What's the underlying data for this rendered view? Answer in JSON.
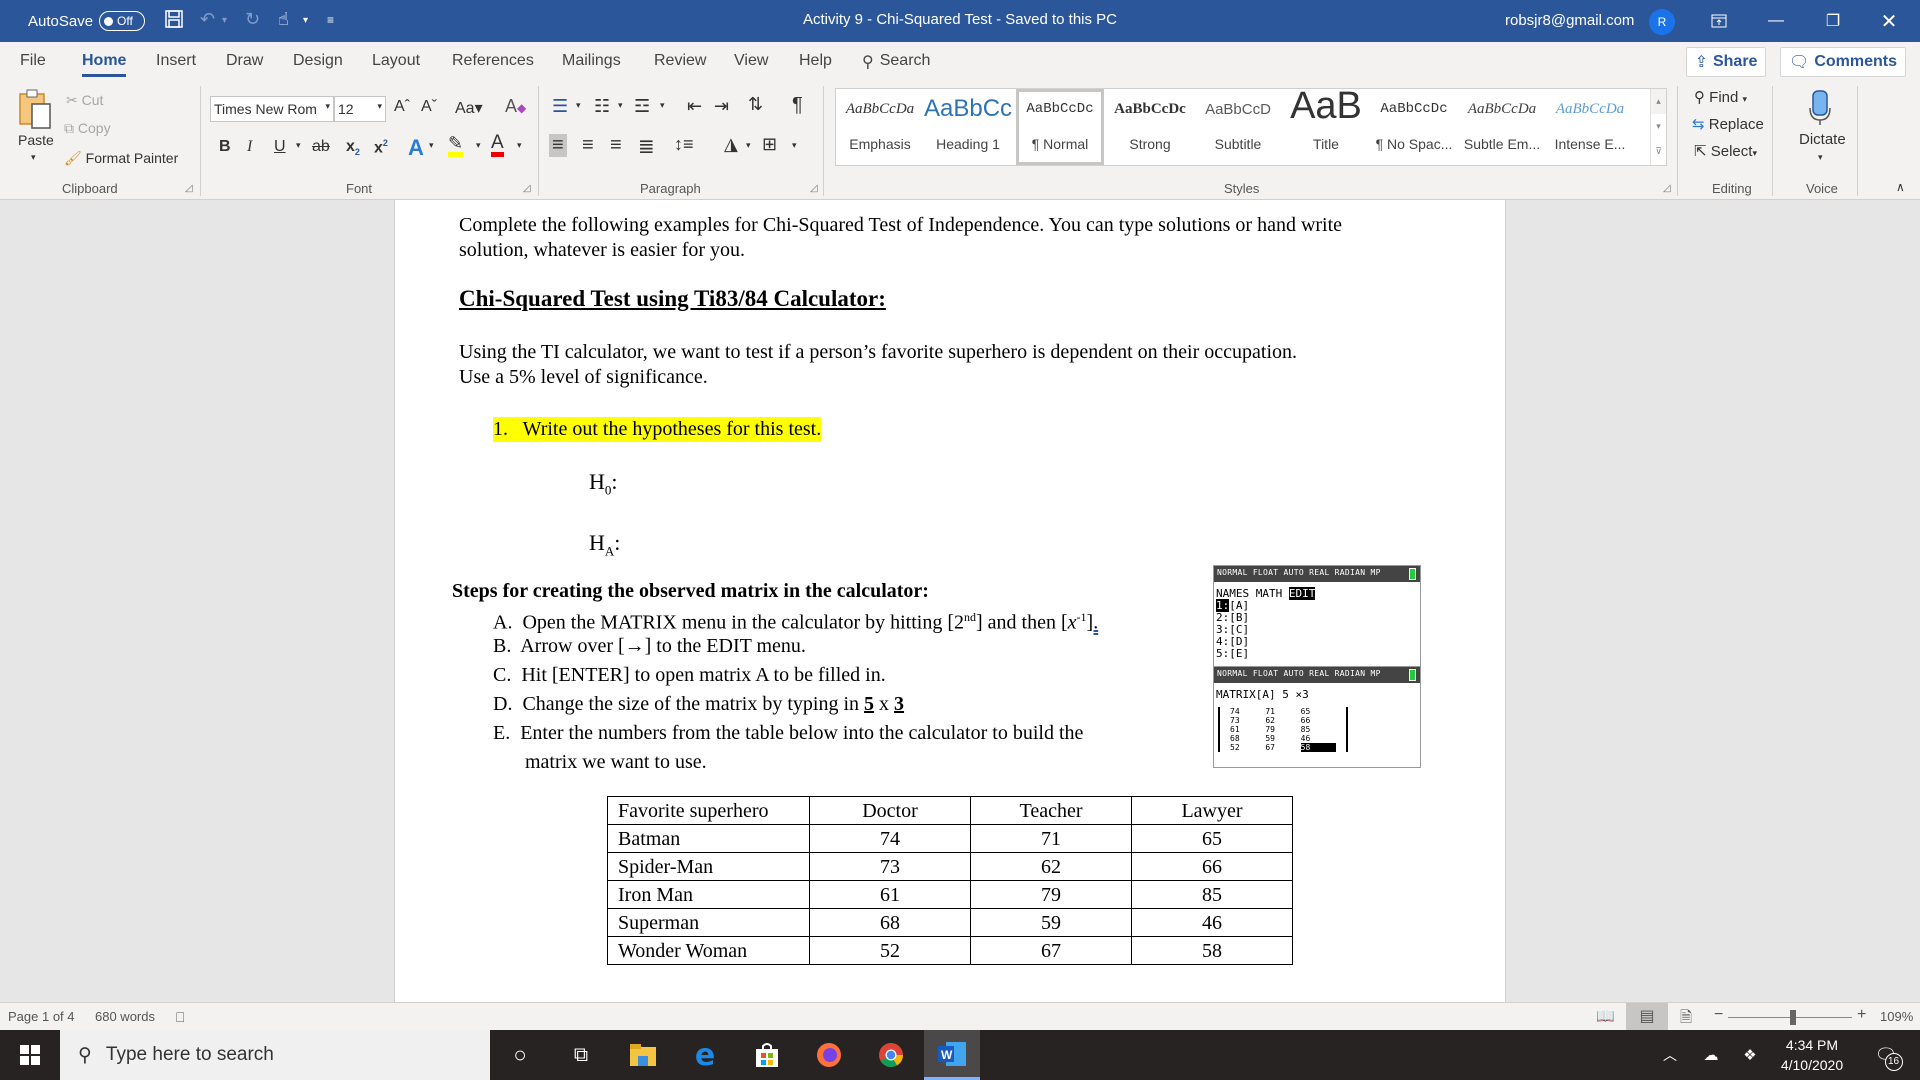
{
  "titlebar": {
    "autosave_label": "AutoSave",
    "autosave_state": "Off",
    "doc_title": "Activity 9 - Chi-Squared Test  -  Saved to this PC",
    "account": "robsjr8@gmail.com",
    "avatar_initial": "R",
    "icons": [
      "save-icon",
      "undo-icon",
      "redo-icon",
      "touch-mode-icon",
      "customize-qat-icon"
    ]
  },
  "menu": {
    "tabs": [
      "File",
      "Home",
      "Insert",
      "Draw",
      "Design",
      "Layout",
      "References",
      "Mailings",
      "Review",
      "View",
      "Help"
    ],
    "active_tab": "Home",
    "search_label": "Search",
    "share_label": "Share",
    "comments_label": "Comments"
  },
  "ribbon": {
    "clipboard": {
      "paste": "Paste",
      "cut": "Cut",
      "copy": "Copy",
      "format_painter": "Format Painter",
      "label": "Clipboard"
    },
    "font": {
      "font_name": "Times New Rom",
      "font_size": "12",
      "label": "Font",
      "change_case": "Aa"
    },
    "paragraph": {
      "label": "Paragraph"
    },
    "styles": {
      "label": "Styles",
      "items": [
        {
          "preview": "AaBbCcDa",
          "name": "Emphasis"
        },
        {
          "preview": "AaBbCc",
          "name": "Heading 1"
        },
        {
          "preview": "AaBbCcDc",
          "name": "¶ Normal"
        },
        {
          "preview": "AaBbCcDc",
          "name": "Strong"
        },
        {
          "preview": "AaBbCcD",
          "name": "Subtitle"
        },
        {
          "preview": "AaB",
          "name": "Title"
        },
        {
          "preview": "AaBbCcDc",
          "name": "¶ No Spac..."
        },
        {
          "preview": "AaBbCcDa",
          "name": "Subtle Em..."
        },
        {
          "preview": "AaBbCcDa",
          "name": "Intense E..."
        }
      ],
      "selected": "¶ Normal"
    },
    "editing": {
      "find": "Find",
      "replace": "Replace",
      "select": "Select",
      "label": "Editing"
    },
    "voice": {
      "dictate": "Dictate",
      "label": "Voice"
    }
  },
  "document": {
    "intro_line1": "Complete the following examples for Chi-Squared Test of Independence. You can type solutions or hand write",
    "intro_line2": "solution, whatever is easier for you.",
    "heading": "Chi-Squared Test using Ti83/84 Calculator:",
    "problem_line1": "Using the TI calculator, we want to test if a person’s favorite superhero is dependent on their occupation.",
    "problem_line2": "Use a 5% level of significance.",
    "q1": "1.   Write out the hypotheses for this test.",
    "h0": "H",
    "h0_sub": "0",
    "ha": "H",
    "ha_sub": "A",
    "colon": ":",
    "steps_heading": "Steps for creating the observed matrix in the calculator:",
    "steps": {
      "A_pre": "A.  Open the MATRIX menu in the calculator by hitting [2",
      "A_sup": "nd",
      "A_mid": "] and then [",
      "A_x": "x",
      "A_sup2": "-1",
      "A_end": "].",
      "B": "B.  Arrow over [→] to the EDIT menu.",
      "C": "C.  Hit [ENTER] to open matrix A to be filled in.",
      "D_pre": "D.  Change the size of the matrix by typing in ",
      "D_5": "5",
      "D_x": " x ",
      "D_3": "3",
      "E1": "E.  Enter the numbers from the table below into the calculator to build the",
      "E2": "matrix we want to use."
    },
    "calculator": {
      "status": "NORMAL FLOAT AUTO REAL RADIAN MP",
      "menu_names": "NAMES",
      "menu_math": "MATH",
      "menu_edit": "EDIT",
      "list": [
        "1:[A]",
        "2:[B]",
        "3:[C]",
        "4:[D]",
        "5:[E]"
      ],
      "matrix_title": "MATRIX[A]  5 ×3",
      "matrix": [
        [
          "74",
          "71",
          "65"
        ],
        [
          "73",
          "62",
          "66"
        ],
        [
          "61",
          "79",
          "85"
        ],
        [
          "68",
          "59",
          "46"
        ],
        [
          "52",
          "67",
          "58"
        ]
      ]
    },
    "table": {
      "headers": [
        "Favorite superhero",
        "Doctor",
        "Teacher",
        "Lawyer"
      ],
      "rows": [
        [
          "Batman",
          "74",
          "71",
          "65"
        ],
        [
          "Spider-Man",
          "73",
          "62",
          "66"
        ],
        [
          "Iron Man",
          "61",
          "79",
          "85"
        ],
        [
          "Superman",
          "68",
          "59",
          "46"
        ],
        [
          "Wonder Woman",
          "52",
          "67",
          "58"
        ]
      ]
    }
  },
  "statusbar": {
    "page": "Page 1 of 4",
    "words": "680 words",
    "zoom": "109%",
    "zoom_level_percent": 109
  },
  "taskbar": {
    "search_placeholder": "Type here to search",
    "time": "4:34 PM",
    "date": "4/10/2020",
    "notifications": "16",
    "apps": [
      "cortana-icon",
      "task-view-icon",
      "file-explorer-icon",
      "edge-icon",
      "store-icon",
      "firefox-icon",
      "chrome-icon",
      "word-icon"
    ]
  },
  "colors": {
    "accent": "#2b579a",
    "highlight": "#ffff00"
  }
}
